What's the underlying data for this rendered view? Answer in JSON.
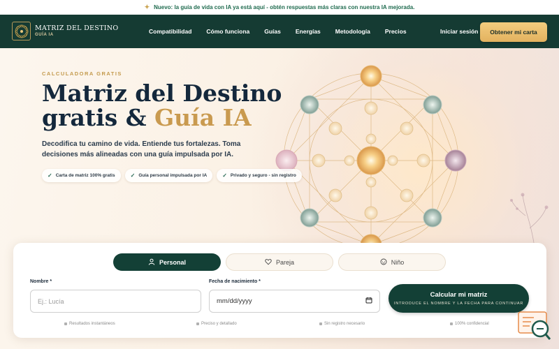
{
  "announcement": {
    "icon": "sparkle-icon",
    "text": "Nuevo: la guía de vida con IA ya está aquí - obtén respuestas más claras con nuestra IA mejorada."
  },
  "brand": {
    "title": "MATRIZ DEL DESTINO",
    "subtitle": "GUÍA IA",
    "logo_icon": "mandala-logo-icon"
  },
  "nav": {
    "links": [
      "Compatibilidad",
      "Cómo funciona",
      "Guías",
      "Energías",
      "Metodología",
      "Precios"
    ],
    "login": "Iniciar sesión",
    "cta": "Obtener mi carta"
  },
  "hero": {
    "eyebrow": "CALCULADORA GRATIS",
    "title_line1": "Matriz del Destino",
    "title_line2_plain": "gratis & ",
    "title_line2_accent": "Guía IA",
    "subtitle": "Decodifica tu camino de vida. Entiende tus fortalezas. Toma decisiones más alineadas con una guía impulsada por IA.",
    "badges": [
      "Carta de matriz 100% gratis",
      "Guía personal impulsada por IA",
      "Privado y seguro - sin registro"
    ]
  },
  "form": {
    "tabs": [
      {
        "label": "Personal",
        "icon": "user-icon",
        "active": true
      },
      {
        "label": "Pareja",
        "icon": "heart-icon",
        "active": false
      },
      {
        "label": "Niño",
        "icon": "child-face-icon",
        "active": false
      }
    ],
    "name_label": "Nombre *",
    "name_placeholder": "Ej.: Lucía",
    "date_label": "Fecha de nacimiento *",
    "date_placeholder": "mm/dd/yyyy",
    "submit_label": "Calcular mi matriz",
    "submit_hint": "INTRODUCE EL NOMBRE Y LA FECHA PARA CONTINUAR",
    "notes": [
      "Resultados instantáneos",
      "Preciso y detallado",
      "Sin registro necesario",
      "100% confidencial"
    ]
  },
  "colors": {
    "brand_dark": "#134036",
    "accent_gold": "#c99a4f",
    "nav_bg": "#153b33"
  }
}
